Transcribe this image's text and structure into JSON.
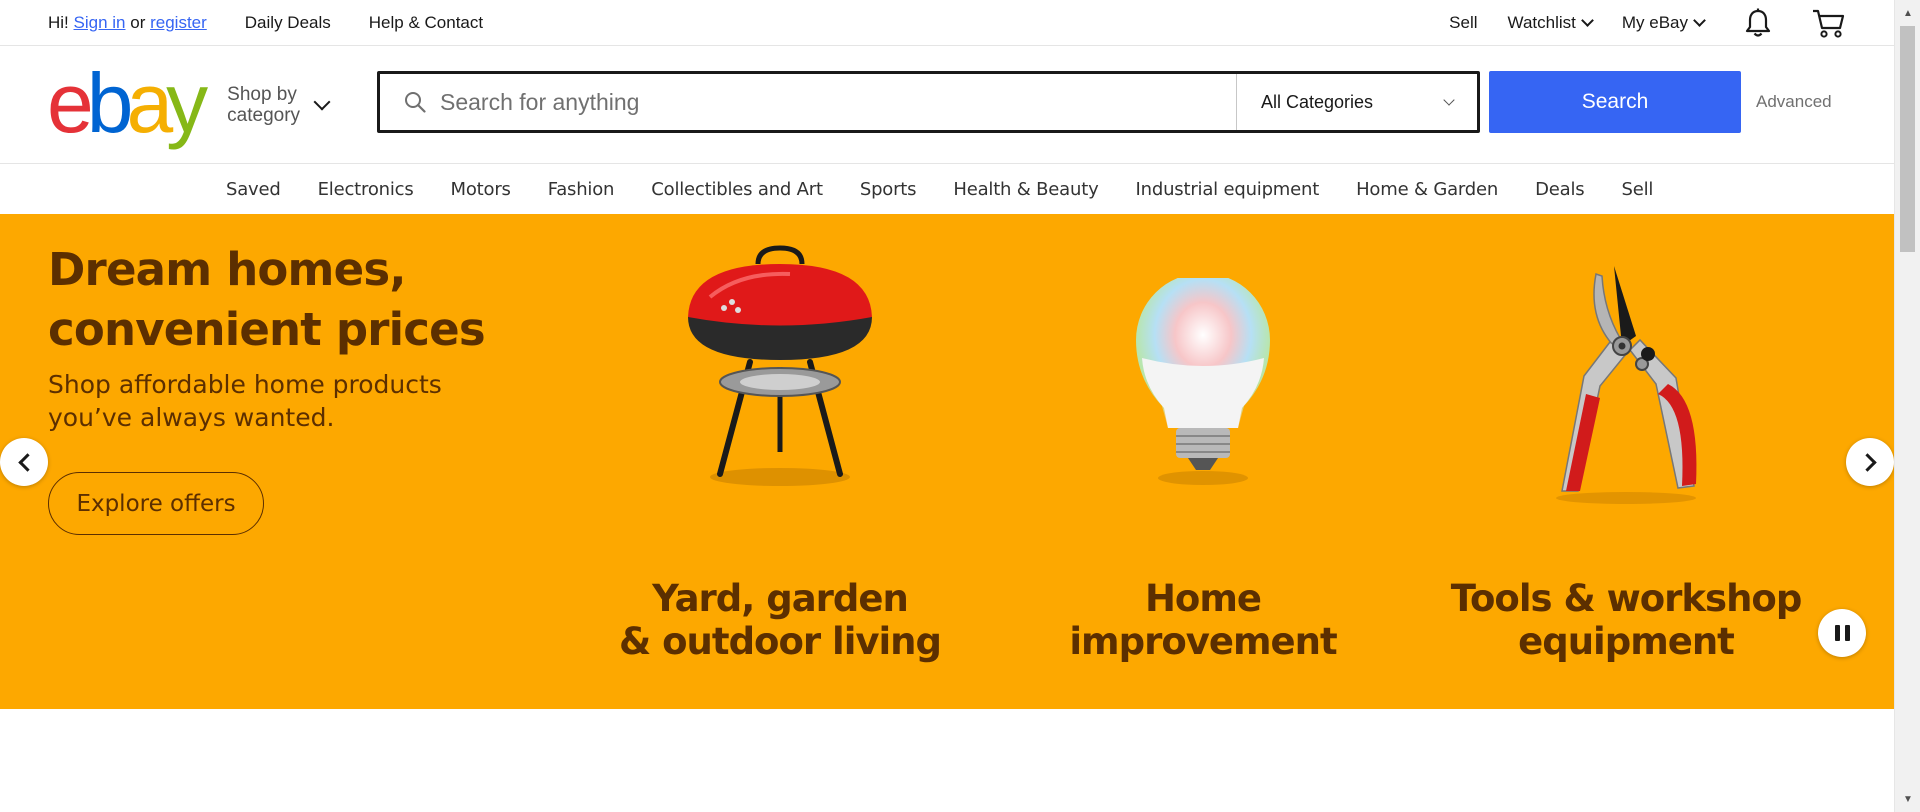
{
  "topbar": {
    "greeting_prefix": "Hi!",
    "sign_in": "Sign in",
    "or": "or",
    "register": "register",
    "daily_deals": "Daily Deals",
    "help_contact": "Help & Contact",
    "sell": "Sell",
    "watchlist": "Watchlist",
    "my_ebay": "My eBay",
    "notification_icon": "bell-icon",
    "cart_icon": "cart-icon"
  },
  "header": {
    "logo_letters": [
      "e",
      "b",
      "a",
      "y"
    ],
    "logo_colors": [
      "#e53238",
      "#0064d2",
      "#f5af02",
      "#86b817"
    ],
    "shop_by_category_line1": "Shop by",
    "shop_by_category_line2": "category",
    "search_placeholder": "Search for anything",
    "category_select": "All Categories",
    "search_button": "Search",
    "advanced": "Advanced"
  },
  "category_nav": [
    "Saved",
    "Electronics",
    "Motors",
    "Fashion",
    "Collectibles and Art",
    "Sports",
    "Health & Beauty",
    "Industrial equipment",
    "Home & Garden",
    "Deals",
    "Sell"
  ],
  "hero": {
    "background": "#fda800",
    "headline": "Dream homes, convenient prices",
    "subtitle": "Shop affordable home products you’ve always wanted.",
    "cta": "Explore offers",
    "tiles": [
      {
        "line1": "Yard, garden",
        "line2": "& outdoor living",
        "icon": "grill-icon"
      },
      {
        "line1": "Home",
        "line2": "improvement",
        "icon": "light-bulb-icon"
      },
      {
        "line1": "Tools & workshop",
        "line2": "equipment",
        "icon": "pruning-shears-icon"
      }
    ]
  },
  "colors": {
    "accent": "#3665f3",
    "hero_text": "#5c2f00"
  }
}
